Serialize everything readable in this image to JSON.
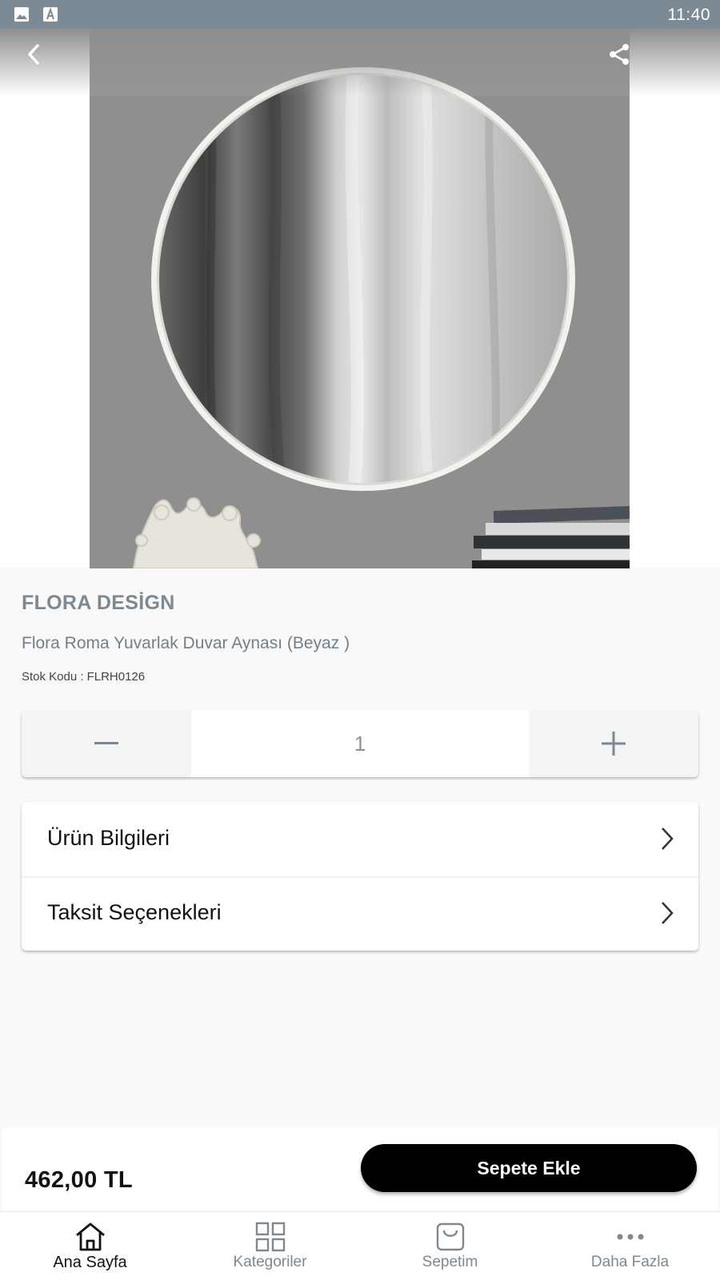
{
  "status_bar": {
    "time": "11:40",
    "icons": [
      "image-icon",
      "font-icon"
    ]
  },
  "header": {
    "back_icon": "chevron-left-icon",
    "share_icon": "share-icon"
  },
  "product": {
    "brand": "FLORA DESİGN",
    "title": "Flora Roma Yuvarlak Duvar Aynası (Beyaz )",
    "sku_label": "Stok Kodu :",
    "sku": "FLRH0126"
  },
  "quantity": {
    "value": "1",
    "decrement_icon": "minus-icon",
    "increment_icon": "plus-icon"
  },
  "info_menu": [
    {
      "label": "Ürün Bilgileri",
      "icon": "chevron-right-icon"
    },
    {
      "label": "Taksit Seçenekleri",
      "icon": "chevron-right-icon"
    }
  ],
  "purchase": {
    "price": "462,00 TL",
    "add_to_cart": "Sepete Ekle"
  },
  "tabbar": [
    {
      "label": "Ana Sayfa",
      "icon": "home-icon",
      "active": true
    },
    {
      "label": "Kategoriler",
      "icon": "grid-icon",
      "active": false
    },
    {
      "label": "Sepetim",
      "icon": "bag-icon",
      "active": false
    },
    {
      "label": "Daha Fazla",
      "icon": "more-icon",
      "active": false
    }
  ],
  "colors": {
    "status_bar": "#7b8a95",
    "muted_text": "#7d8890",
    "primary_button": "#000000",
    "background": "#f9f9f9"
  }
}
